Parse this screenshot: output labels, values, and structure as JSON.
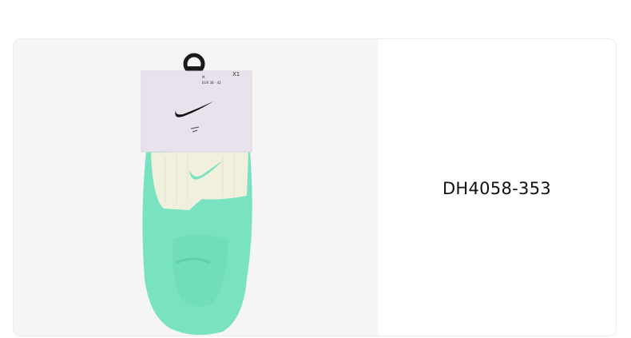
{
  "product": {
    "sku": "DH4058-353",
    "image_alt": "Nike socks pack — mint green socks with cream cuff",
    "tag": {
      "size": "M",
      "size_range": "EUR 38 - 42",
      "quantity": "X1"
    },
    "colors": {
      "sock_body": "#79e2c1",
      "sock_cuff": "#f1f0de",
      "tag": "#e9e2ec",
      "panel_bg": "#f5f5f5"
    }
  }
}
